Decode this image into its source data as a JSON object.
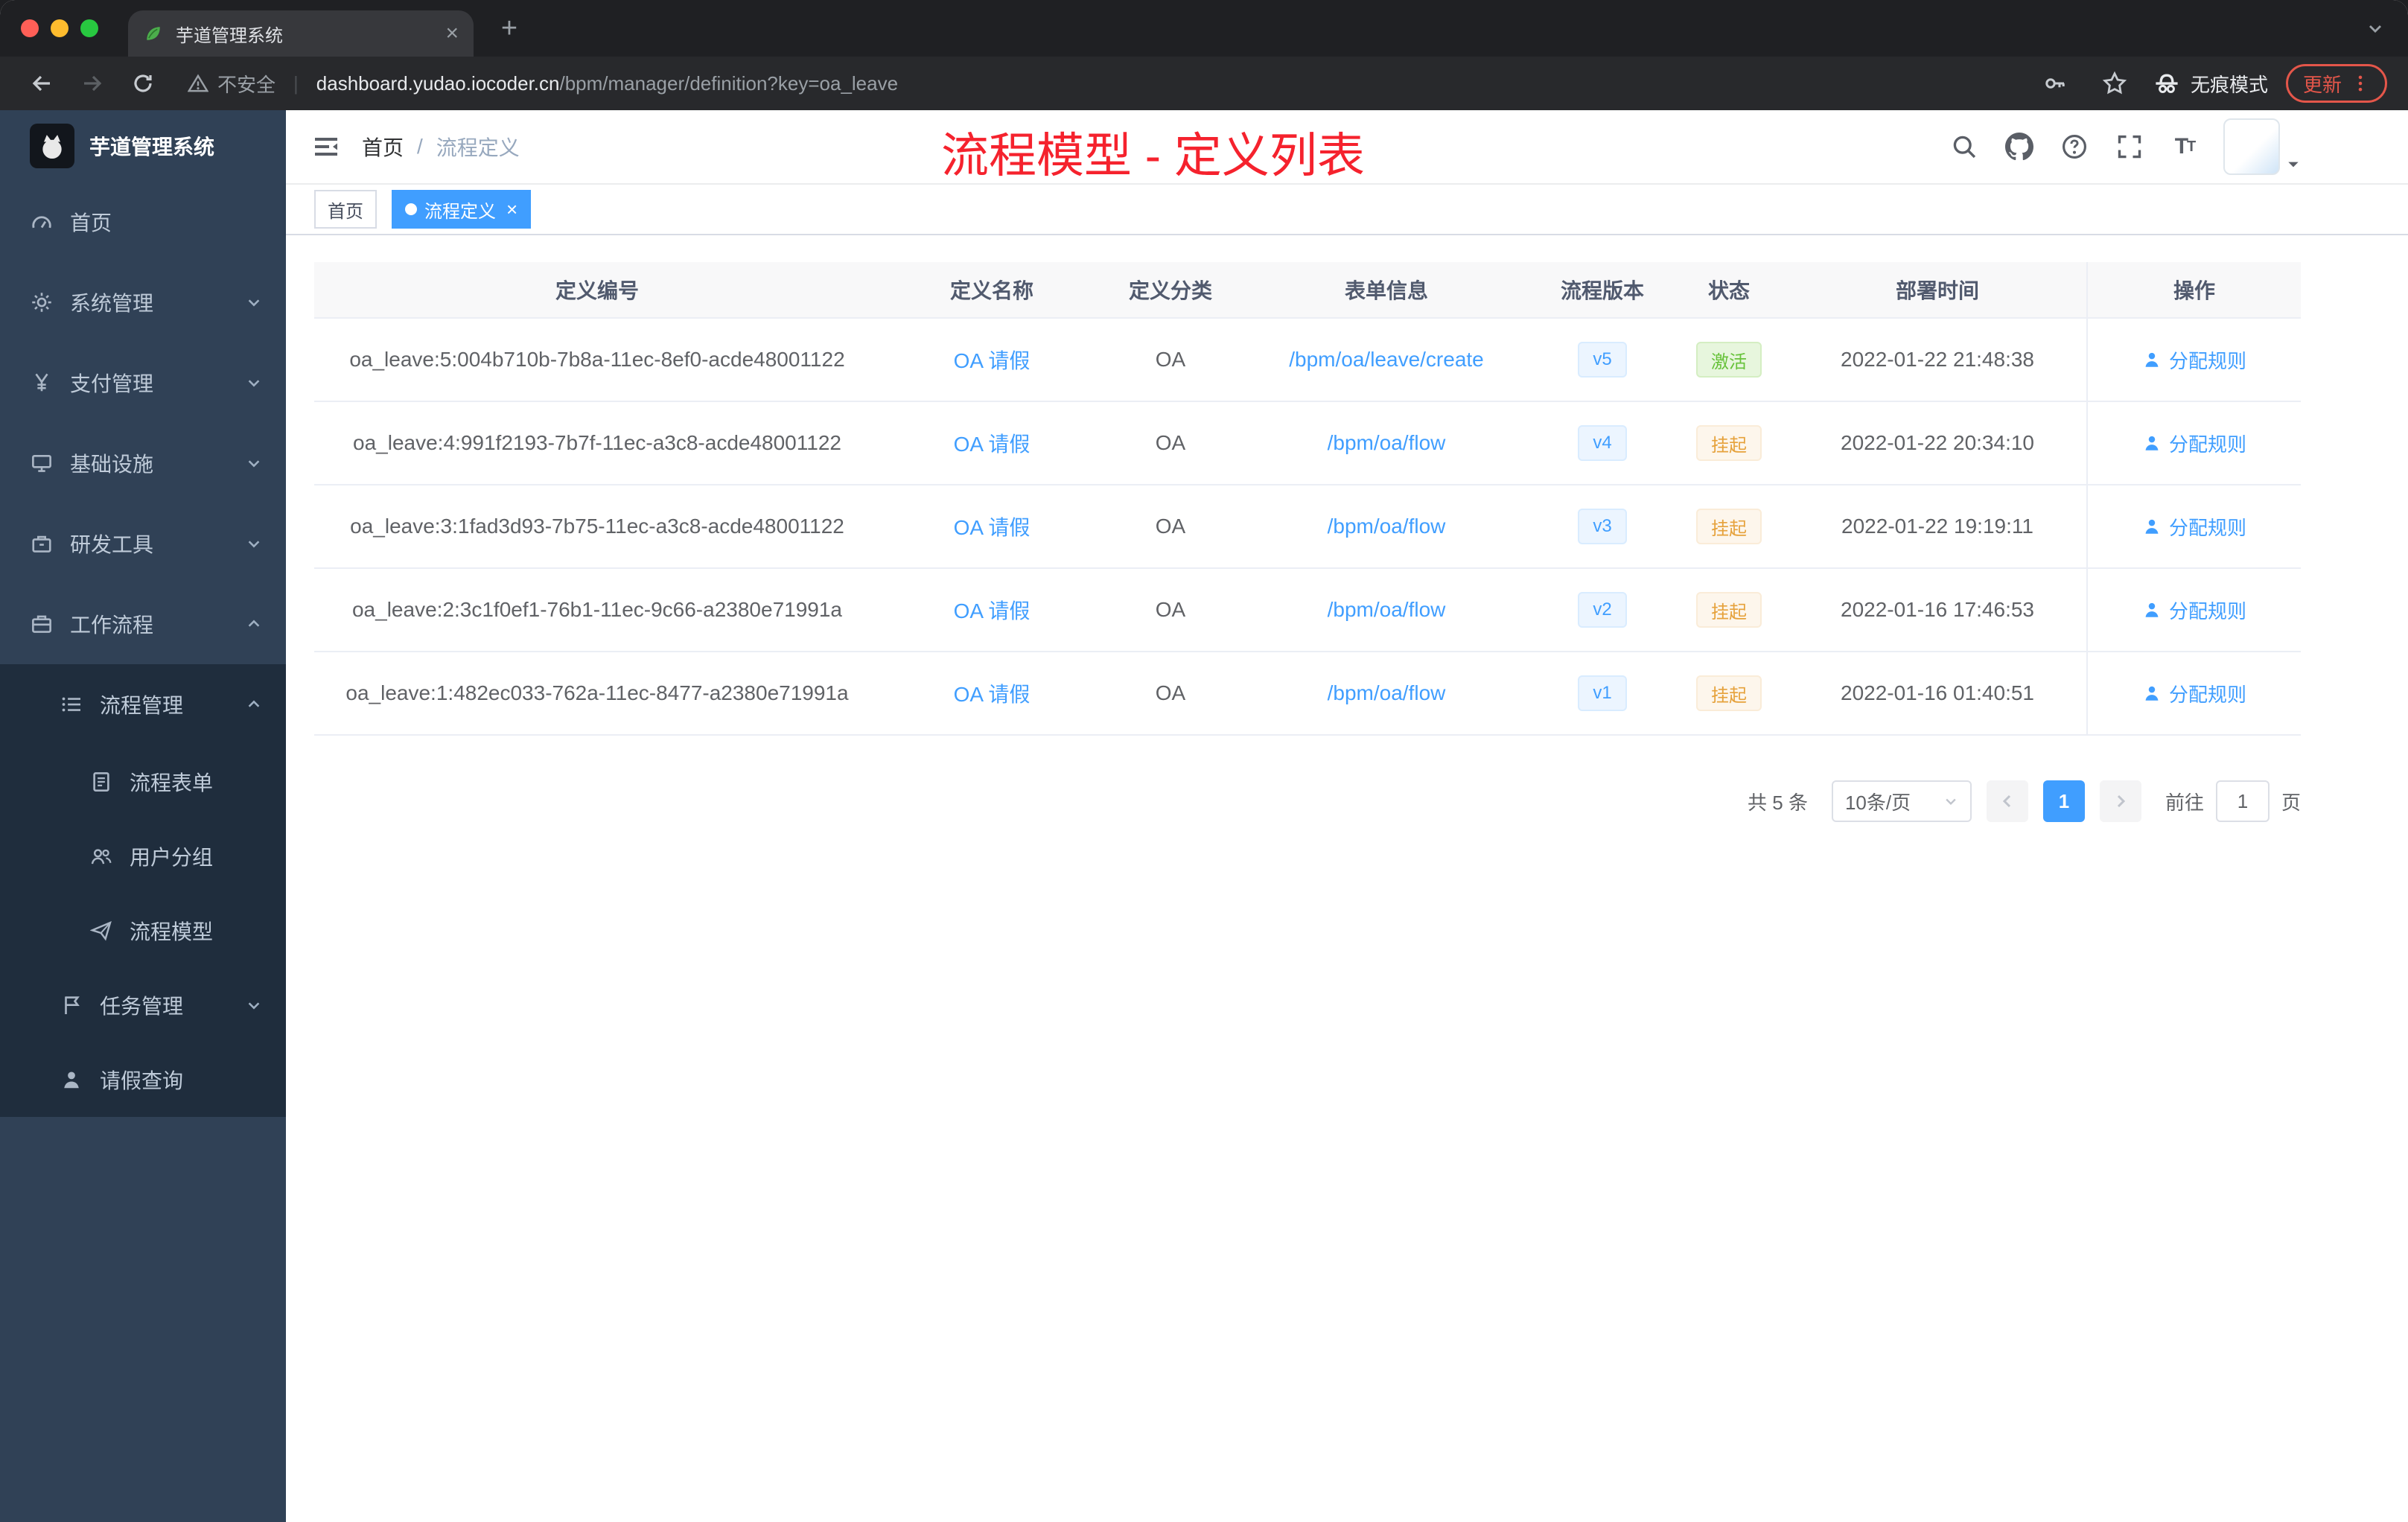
{
  "browser": {
    "tab": {
      "title": "芋道管理系统"
    },
    "address": {
      "security_label": "不安全",
      "host": "dashboard.yudao.iocoder.cn",
      "path": "/bpm/manager/definition?key=oa_leave"
    },
    "incognito_label": "无痕模式",
    "update_label": "更新"
  },
  "sidebar": {
    "app_title": "芋道管理系统",
    "items": [
      {
        "label": "首页",
        "icon": "dashboard-icon"
      },
      {
        "label": "系统管理",
        "icon": "gear-icon"
      },
      {
        "label": "支付管理",
        "icon": "yen-icon"
      },
      {
        "label": "基础设施",
        "icon": "infra-icon"
      },
      {
        "label": "研发工具",
        "icon": "tools-icon"
      },
      {
        "label": "工作流程",
        "icon": "workflow-icon"
      },
      {
        "label": "流程管理",
        "icon": "process-list-icon"
      },
      {
        "label": "流程表单",
        "icon": "form-icon"
      },
      {
        "label": "用户分组",
        "icon": "user-group-icon"
      },
      {
        "label": "流程模型",
        "icon": "paper-plane-icon"
      },
      {
        "label": "任务管理",
        "icon": "task-icon"
      },
      {
        "label": "请假查询",
        "icon": "person-icon"
      }
    ]
  },
  "navbar": {
    "breadcrumb": [
      "首页",
      "流程定义"
    ],
    "annotation": "流程模型 - 定义列表"
  },
  "tags": [
    {
      "label": "首页"
    },
    {
      "label": "流程定义"
    }
  ],
  "table": {
    "columns": [
      "定义编号",
      "定义名称",
      "定义分类",
      "表单信息",
      "流程版本",
      "状态",
      "部署时间",
      "操作"
    ],
    "rows": [
      {
        "id": "oa_leave:5:004b710b-7b8a-11ec-8ef0-acde48001122",
        "name": "OA 请假",
        "category": "OA",
        "form": "/bpm/oa/leave/create",
        "version": "v5",
        "status": "激活",
        "status_type": "success",
        "time": "2022-01-22 21:48:38",
        "action": "分配规则"
      },
      {
        "id": "oa_leave:4:991f2193-7b7f-11ec-a3c8-acde48001122",
        "name": "OA 请假",
        "category": "OA",
        "form": "/bpm/oa/flow",
        "version": "v4",
        "status": "挂起",
        "status_type": "warning",
        "time": "2022-01-22 20:34:10",
        "action": "分配规则"
      },
      {
        "id": "oa_leave:3:1fad3d93-7b75-11ec-a3c8-acde48001122",
        "name": "OA 请假",
        "category": "OA",
        "form": "/bpm/oa/flow",
        "version": "v3",
        "status": "挂起",
        "status_type": "warning",
        "time": "2022-01-22 19:19:11",
        "action": "分配规则"
      },
      {
        "id": "oa_leave:2:3c1f0ef1-76b1-11ec-9c66-a2380e71991a",
        "name": "OA 请假",
        "category": "OA",
        "form": "/bpm/oa/flow",
        "version": "v2",
        "status": "挂起",
        "status_type": "warning",
        "time": "2022-01-16 17:46:53",
        "action": "分配规则"
      },
      {
        "id": "oa_leave:1:482ec033-762a-11ec-8477-a2380e71991a",
        "name": "OA 请假",
        "category": "OA",
        "form": "/bpm/oa/flow",
        "version": "v1",
        "status": "挂起",
        "status_type": "warning",
        "time": "2022-01-16 01:40:51",
        "action": "分配规则"
      }
    ]
  },
  "pagination": {
    "total": "共 5 条",
    "page_size": "10条/页",
    "page": "1",
    "goto_label": "前往",
    "goto_value": "1",
    "unit_label": "页"
  },
  "colors": {
    "accent": "#409eff",
    "success": "#67c23a",
    "warning": "#e6a23c",
    "annotation": "#f5222d",
    "sidebar-bg": "#304156",
    "submenu-bg": "#1f2d3d"
  }
}
